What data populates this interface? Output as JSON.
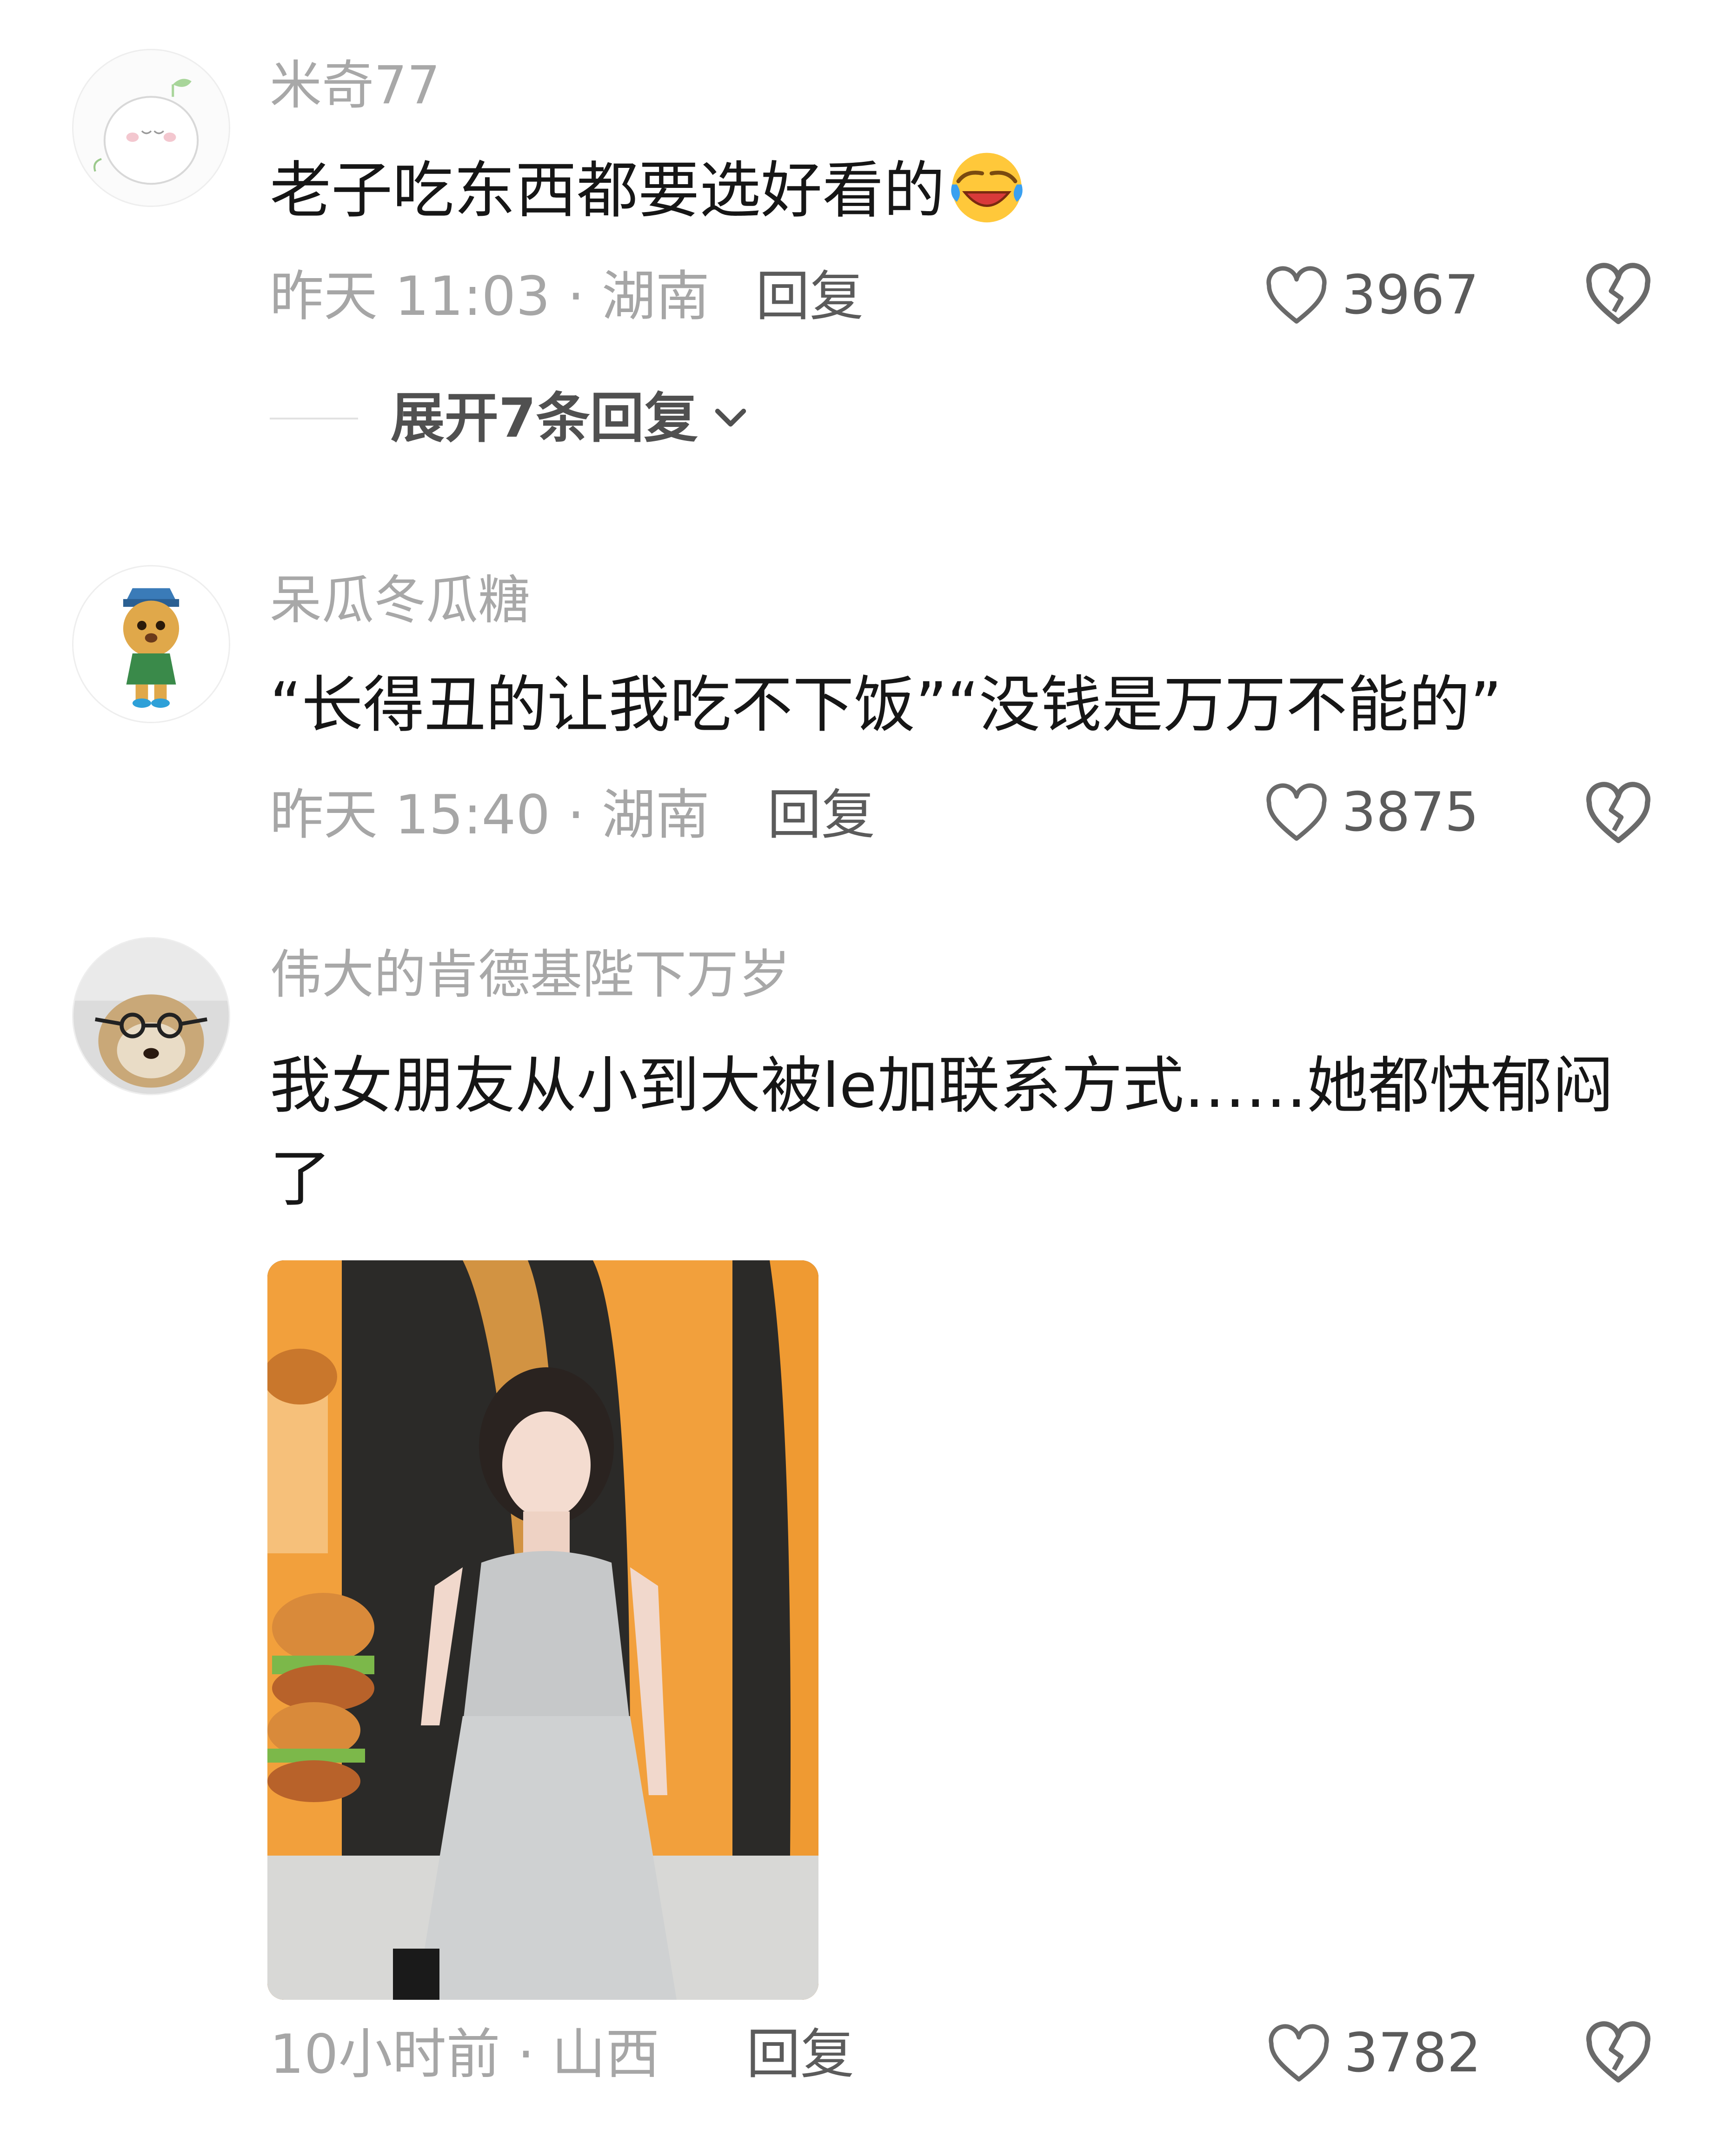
{
  "comments": [
    {
      "username": "米奇77",
      "text": "老子吃东西都要选好看的",
      "emoji": "laughing-crying-emoji",
      "time": "昨天 11:03",
      "location": "湖南",
      "reply": "回复",
      "likes": "3967",
      "expand": "展开7条回复"
    },
    {
      "username": "呆瓜冬瓜糖",
      "text": "“长得丑的让我吃不下饭”“没钱是万万不能的”",
      "time": "昨天 15:40",
      "location": "湖南",
      "reply": "回复",
      "likes": "3875"
    },
    {
      "username": "伟大的肯德基陛下万岁",
      "text": "我女朋友从小到大被le加联系方式……她都快郁闷了",
      "time": "10小时前",
      "location": "山西",
      "reply": "回复",
      "likes": "3782"
    }
  ],
  "separator": " · ",
  "colors": {
    "meta": "#a6a6a6",
    "text": "#161616",
    "accent_orange": "#f2a03c"
  },
  "icons": {
    "like": "heart-outline-icon",
    "dislike": "broken-heart-icon",
    "expand": "chevron-down-icon"
  }
}
